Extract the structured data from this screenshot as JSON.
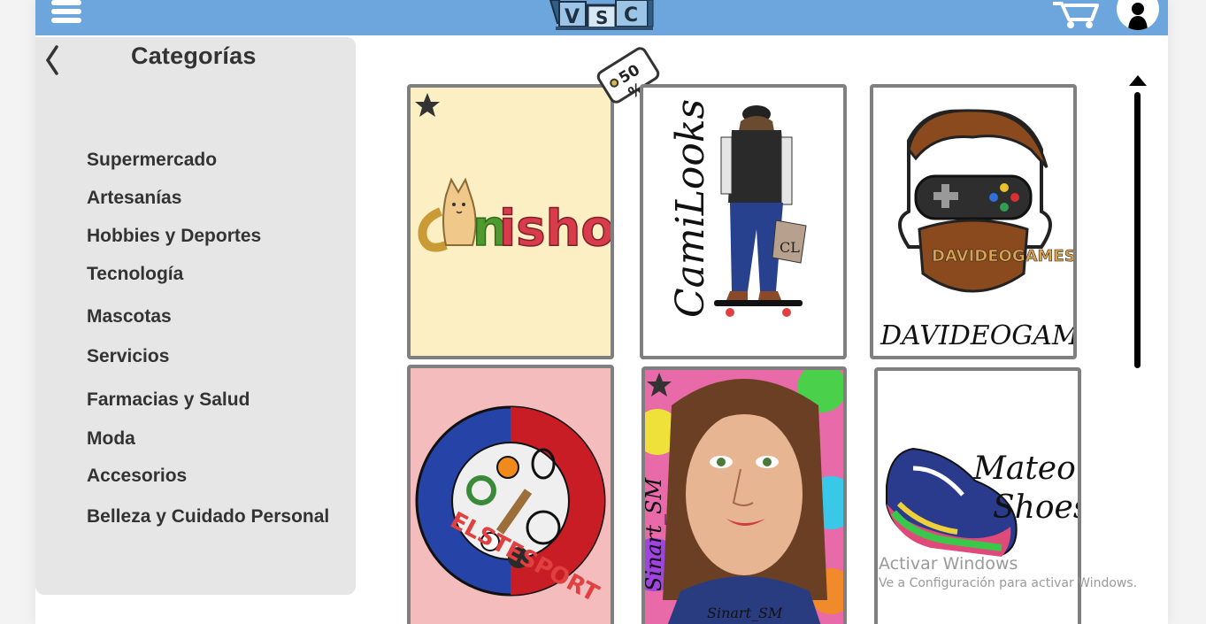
{
  "header": {
    "logo_text": "VSC",
    "menu_icon": "hamburger-icon",
    "cart_icon": "cart-icon",
    "user_icon": "user-icon"
  },
  "sidebar": {
    "back_icon": "chevron-left-icon",
    "title": "Categorías",
    "items": [
      {
        "label": "Supermercado"
      },
      {
        "label": "Artesanías"
      },
      {
        "label": "Hobbies y Deportes"
      },
      {
        "label": "Tecnología"
      },
      {
        "label": "Mascotas"
      },
      {
        "label": "Servicios"
      },
      {
        "label": "Farmacias y Salud"
      },
      {
        "label": "Moda"
      },
      {
        "label": "Accesorios"
      },
      {
        "label": "Belleza y Cuidado Personal"
      }
    ]
  },
  "discount_badge": "50 %",
  "stores": [
    {
      "name": "canishop",
      "featured": true,
      "background": "#fdefc4"
    },
    {
      "name": "CamiLooks",
      "featured": false,
      "background": "#ffffff"
    },
    {
      "name": "DAVIDEOGAMES",
      "featured": false,
      "background": "#ffffff"
    },
    {
      "name": "ELSTESPORT",
      "featured": false,
      "background": "#f4bcbd"
    },
    {
      "name": "Sinart_SM",
      "featured": true,
      "background": "#8fd9c4"
    },
    {
      "name": "Mateo Shoes",
      "featured": false,
      "background": "#ffffff"
    }
  ],
  "colors": {
    "header": "#6ca6dd",
    "sidebar": "#e6e6e6",
    "card_border": "#7f7f7f"
  },
  "watermark": {
    "title": "Activar Windows",
    "subtitle": "Ve a Configuración para activar Windows."
  }
}
